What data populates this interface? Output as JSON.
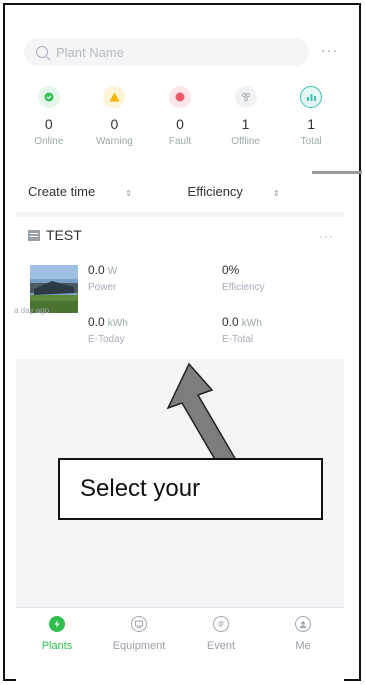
{
  "search": {
    "placeholder": "Plant Name",
    "more": "···"
  },
  "stats": [
    {
      "value": "0",
      "label": "Online",
      "icon": "check-dot-icon",
      "color": "#35c25a"
    },
    {
      "value": "0",
      "label": "Warning",
      "icon": "warning-icon",
      "color": "#f5b400"
    },
    {
      "value": "0",
      "label": "Fault",
      "icon": "fault-icon",
      "color": "#f15a6a"
    },
    {
      "value": "1",
      "label": "Offline",
      "icon": "offline-icon",
      "color": "#aab0b8"
    },
    {
      "value": "1",
      "label": "Total",
      "icon": "chart-icon",
      "color": "#3cc0b0"
    }
  ],
  "sort": {
    "create_time": "Create time",
    "efficiency": "Efficiency",
    "arrows": "⇕"
  },
  "plant": {
    "name": "TEST",
    "more": "···",
    "power_value": "0.0",
    "power_unit": "W",
    "power_label": "Power",
    "efficiency_value": "0%",
    "efficiency_label": "Efficiency",
    "etoday_value": "0.0",
    "etoday_unit": "kWh",
    "etoday_label": "E-Today",
    "etotal_value": "0.0",
    "etotal_unit": "kWh",
    "etotal_label": "E-Total",
    "updated": "a day ago"
  },
  "callout": {
    "text": "Select your"
  },
  "tabs": [
    {
      "label": "Plants",
      "icon": "bolt-icon",
      "active": true
    },
    {
      "label": "Equipment",
      "icon": "equipment-icon",
      "active": false
    },
    {
      "label": "Event",
      "icon": "event-icon",
      "active": false
    },
    {
      "label": "Me",
      "icon": "user-icon",
      "active": false
    }
  ],
  "colors": {
    "accent": "#2fbf4f",
    "bg": "#f4f5f7"
  }
}
